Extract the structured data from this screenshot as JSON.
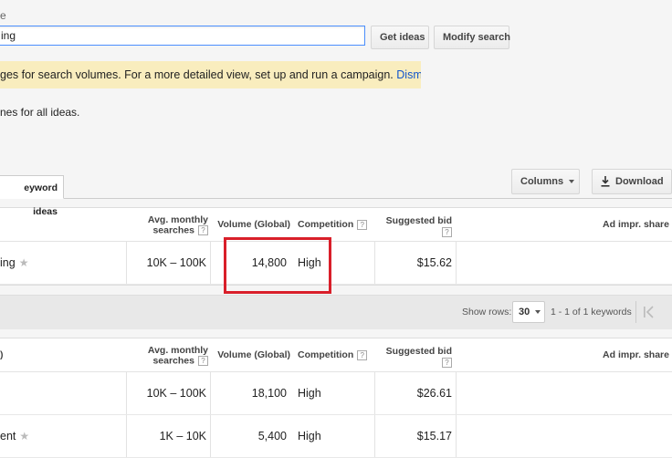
{
  "header": {
    "field_label": "e",
    "keyword_value": "ing",
    "get_ideas_label": "Get ideas",
    "modify_search_label": "Modify search"
  },
  "notice": {
    "text": "ges for search volumes. For a more detailed view, set up and run a campaign. ",
    "dismiss_label": "Dismiss"
  },
  "sub_note": "nes for all ideas.",
  "tabs": {
    "keyword_ideas": "eyword ideas"
  },
  "toolbar": {
    "columns_label": "Columns",
    "download_label": "Download"
  },
  "columns": {
    "avg_monthly": "Avg. monthly searches",
    "volume_global": "Volume (Global)",
    "competition": "Competition",
    "suggested_bid": "Suggested bid",
    "ad_impr_share": "Ad impr. share",
    "help_glyph": "?"
  },
  "search_terms_table": {
    "rows": [
      {
        "keyword": "ing",
        "avg_monthly": "10K – 100K",
        "volume": "14,800",
        "competition": "High",
        "bid": "$15.62"
      }
    ]
  },
  "pager": {
    "show_rows_label": "Show rows:",
    "rows_value": "30",
    "range_label": "1 - 1 of 1 keywords"
  },
  "ideas_table": {
    "group_header": ")",
    "rows": [
      {
        "keyword": "",
        "avg_monthly": "10K – 100K",
        "volume": "18,100",
        "competition": "High",
        "bid": "$26.61"
      },
      {
        "keyword": "ent",
        "avg_monthly": "1K – 10K",
        "volume": "5,400",
        "competition": "High",
        "bid": "$15.17"
      }
    ]
  },
  "colors": {
    "accent": "#15c",
    "highlight_box": "#d91f2a",
    "notice_bg": "#f9edbe"
  }
}
